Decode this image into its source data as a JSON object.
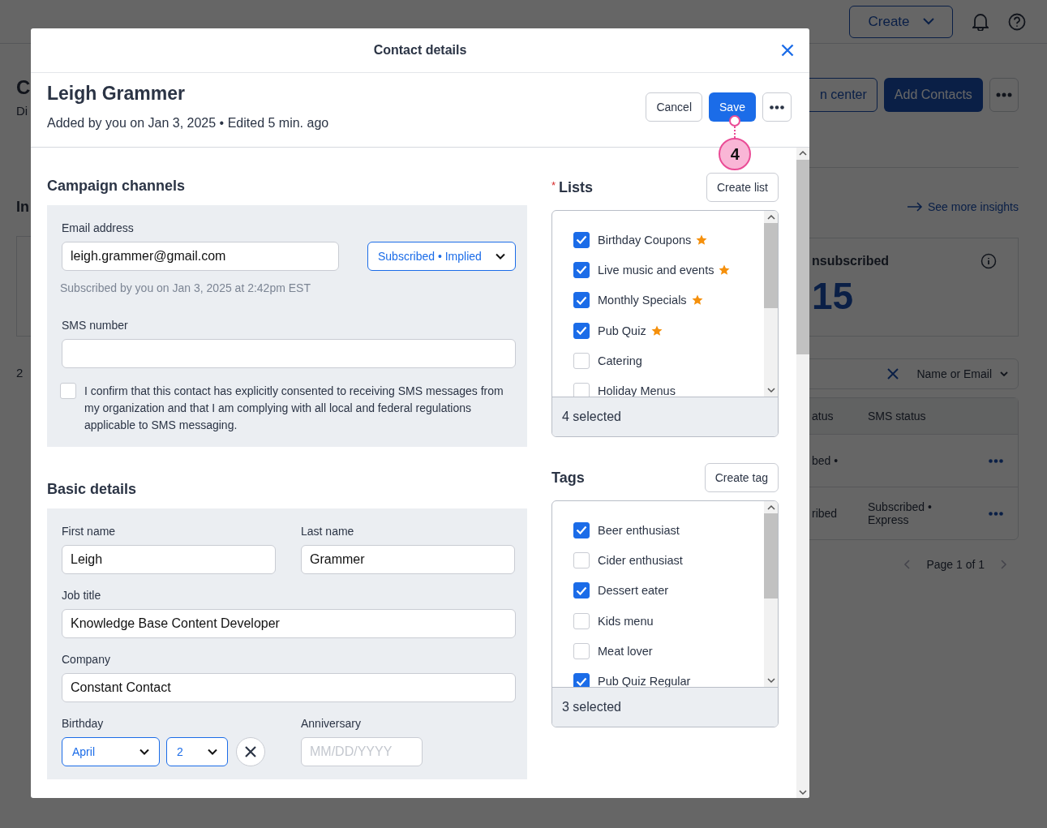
{
  "background": {
    "create_button": "Create",
    "left_fragments": {
      "title": "C",
      "subtitle": "Di",
      "section": "In",
      "count": "2"
    },
    "help_center_button": "n center",
    "add_contacts_button": "Add Contacts",
    "insights_link": "See more insights",
    "stat": {
      "label": "nsubscribed",
      "value": "15"
    },
    "search_filter": "Name or Email",
    "table": {
      "columns": [
        "atus",
        "SMS status"
      ],
      "rows": [
        [
          "bed •",
          ""
        ],
        [
          "ribed",
          "Subscribed • Express"
        ]
      ]
    },
    "pagination": "Page 1 of 1"
  },
  "dialog": {
    "title": "Contact details",
    "contact": {
      "name": "Leigh Grammer",
      "meta": "Added by you on Jan 3, 2025 • Edited 5 min. ago"
    },
    "buttons": {
      "cancel": "Cancel",
      "save": "Save"
    },
    "callout": "4",
    "campaign_channels": {
      "heading": "Campaign channels",
      "email_label": "Email address",
      "email_value": "leigh.grammer@gmail.com",
      "email_status": "Subscribed • Implied",
      "email_note": "Subscribed by you on Jan 3, 2025 at 2:42pm EST",
      "sms_label": "SMS number",
      "sms_consent": {
        "checked": false,
        "text": "I confirm that this contact has explicitly consented to receiving SMS messages from my organization and that I am complying with all local and federal regulations applicable to SMS messaging."
      }
    },
    "basic_details": {
      "heading": "Basic details",
      "first_name_label": "First name",
      "first_name": "Leigh",
      "last_name_label": "Last name",
      "last_name": "Grammer",
      "job_title_label": "Job title",
      "job_title": "Knowledge Base Content Developer",
      "company_label": "Company",
      "company": "Constant Contact",
      "birthday_label": "Birthday",
      "birthday_month": "April",
      "birthday_day": "2",
      "anniversary_label": "Anniversary",
      "anniversary_placeholder": "MM/DD/YYYY"
    },
    "lists": {
      "heading": "Lists",
      "required_mark": "*",
      "create_button": "Create list",
      "summary": "4 selected",
      "items": [
        {
          "label": "Birthday Coupons",
          "checked": true,
          "starred": true
        },
        {
          "label": "Live music and events",
          "checked": true,
          "starred": true
        },
        {
          "label": "Monthly Specials",
          "checked": true,
          "starred": true
        },
        {
          "label": "Pub Quiz",
          "checked": true,
          "starred": true
        },
        {
          "label": "Catering",
          "checked": false,
          "starred": false
        },
        {
          "label": "Holiday Menus",
          "checked": false,
          "starred": false
        }
      ]
    },
    "tags": {
      "heading": "Tags",
      "create_button": "Create tag",
      "summary": "3 selected",
      "items": [
        {
          "label": "Beer enthusiast",
          "checked": true
        },
        {
          "label": "Cider enthusiast",
          "checked": false
        },
        {
          "label": "Dessert eater",
          "checked": true
        },
        {
          "label": "Kids menu",
          "checked": false
        },
        {
          "label": "Meat lover",
          "checked": false
        },
        {
          "label": "Pub Quiz Regular",
          "checked": true
        }
      ]
    }
  }
}
